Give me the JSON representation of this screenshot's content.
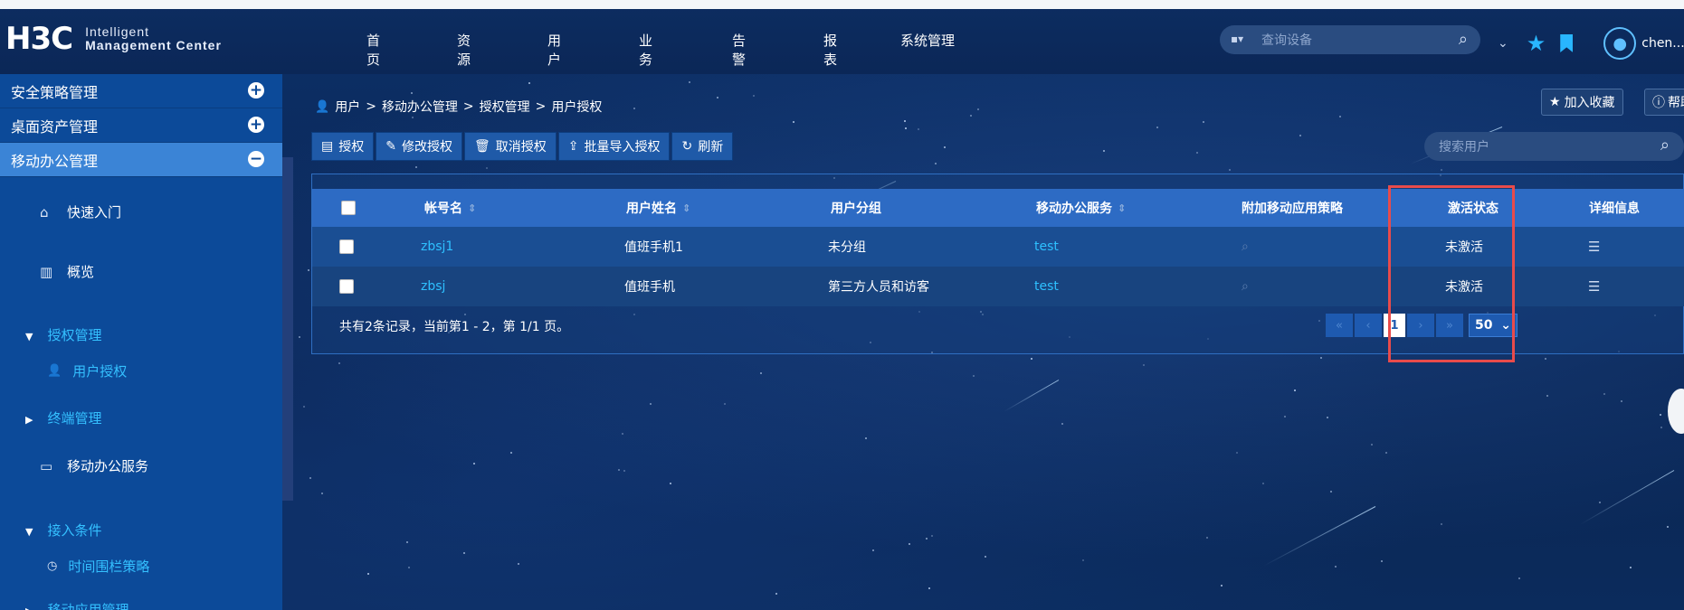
{
  "app": {
    "logo_mark": "H3C",
    "logo_line1": "Intelligent",
    "logo_line2_a": "Management",
    "logo_line2_b": "Center"
  },
  "nav": {
    "items": [
      "首页",
      "资源",
      "用户",
      "业务",
      "告警",
      "报表",
      "系统管理"
    ]
  },
  "top_search": {
    "placeholder": "查询设备"
  },
  "user": {
    "name": "chen..."
  },
  "sidebar": {
    "categories": [
      {
        "label": "安全策略管理",
        "state": "expand"
      },
      {
        "label": "桌面资产管理",
        "state": "expand"
      },
      {
        "label": "移动办公管理",
        "state": "collapse"
      }
    ],
    "items": [
      {
        "label": "快速入门",
        "icon": "home-icon"
      },
      {
        "label": "概览",
        "icon": "overview-icon"
      }
    ],
    "groups": [
      {
        "label": "授权管理",
        "expanded": true
      },
      {
        "label": "终端管理",
        "expanded": false
      },
      {
        "label": "接入条件",
        "expanded": true
      },
      {
        "label": "移动应用管理",
        "expanded": false
      }
    ],
    "subitems": [
      {
        "label": "用户授权",
        "icon": "user-auth-icon"
      },
      {
        "label": "移动办公服务",
        "icon": "mobile-office-icon"
      },
      {
        "label": "时间围栏策略",
        "icon": "clock-fence-icon"
      }
    ]
  },
  "breadcrumb": [
    "用户",
    "移动办公管理",
    "授权管理",
    "用户授权"
  ],
  "breadcrumb_sep": ">",
  "header_buttons": {
    "favorite": "加入收藏",
    "help": "帮助"
  },
  "toolbar": {
    "authorize": "授权",
    "modify": "修改授权",
    "cancel": "取消授权",
    "batch_import": "批量导入授权",
    "refresh": "刷新"
  },
  "user_search": {
    "placeholder": "搜索用户"
  },
  "table": {
    "columns": [
      "帐号名",
      "用户姓名",
      "用户分组",
      "移动办公服务",
      "附加移动应用策略",
      "激活状态",
      "详细信息"
    ],
    "rows": [
      {
        "account": "zbsj1",
        "name": "值班手机1",
        "group": "未分组",
        "service": "test",
        "status": "未激活"
      },
      {
        "account": "zbsj",
        "name": "值班手机",
        "group": "第三方人员和访客",
        "service": "test",
        "status": "未激活"
      }
    ],
    "summary": "共有2条记录，当前第1 - 2，第 1/1 页。",
    "current_page": "1",
    "page_size": "50"
  },
  "colors": {
    "sidebar_bg": "#0c4a99",
    "active_category": "#3b84d6",
    "table_header": "#2d6bc4",
    "link": "#2ec0ff",
    "highlight_box": "#e84b4b",
    "accent_icon": "#29b6ff"
  }
}
